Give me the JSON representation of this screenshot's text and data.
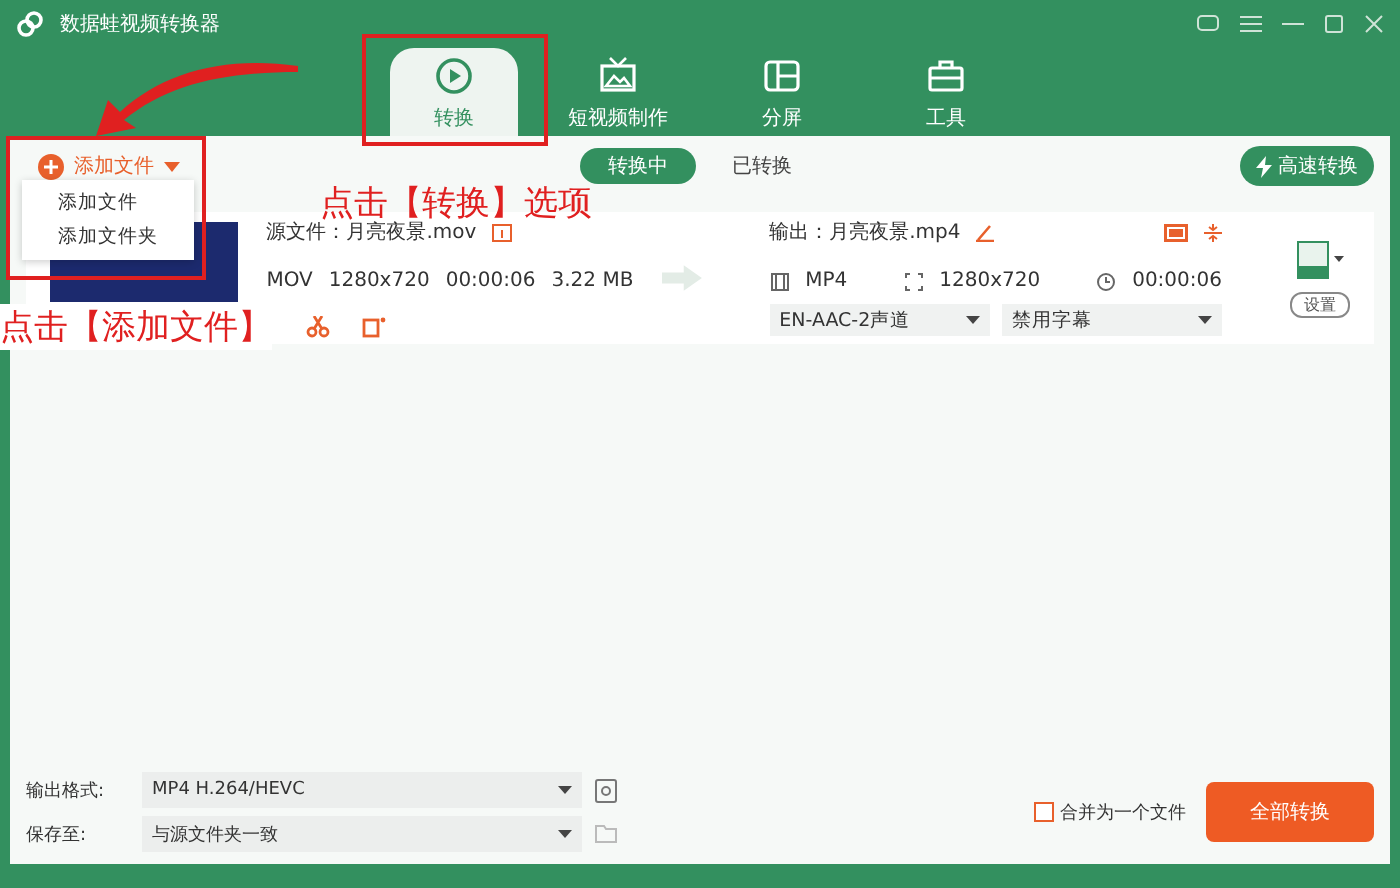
{
  "window": {
    "title": "数据蛙视频转换器"
  },
  "tabs": [
    {
      "label": "转换",
      "selected": true
    },
    {
      "label": "短视频制作",
      "selected": false
    },
    {
      "label": "分屏",
      "selected": false
    },
    {
      "label": "工具",
      "selected": false
    }
  ],
  "toolbar": {
    "add_button": "添加文件",
    "menu": [
      "添加文件",
      "添加文件夹"
    ],
    "filter_tabs": [
      {
        "label": "转换中",
        "selected": true
      },
      {
        "label": "已转换",
        "selected": false
      }
    ],
    "fast_button": "高速转换"
  },
  "file": {
    "source": "源文件：月亮夜景.mov",
    "format": "MOV",
    "resolution": "1280x720",
    "duration": "00:00:06",
    "size": "3.22 MB",
    "output": "输出：月亮夜景.mp4",
    "out_format": "MP4",
    "out_resolution": "1280x720",
    "out_duration": "00:00:06",
    "audio": "EN-AAC-2声道",
    "subtitle": "禁用字幕",
    "settings": "设置"
  },
  "bottom": {
    "format_label": "输出格式:",
    "format_value": "MP4 H.264/HEVC",
    "save_label": "保存至:",
    "save_value": "与源文件夹一致",
    "merge": {
      "label": "合并为一个文件",
      "checked": false
    },
    "convert_all": "全部转换"
  },
  "annotations": [
    {
      "text": "点击【转换】选项"
    },
    {
      "text": "点击【添加文件】"
    }
  ]
}
